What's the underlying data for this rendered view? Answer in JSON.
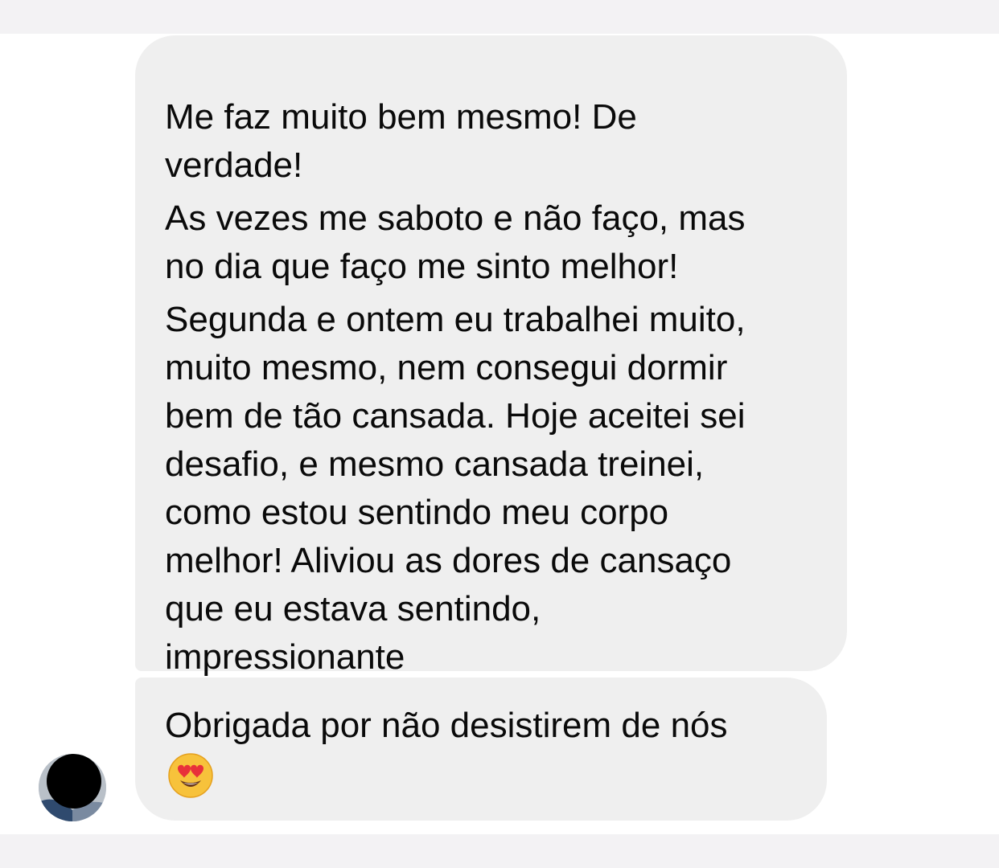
{
  "thread": {
    "messages": [
      {
        "paragraphs": [
          "Me faz muito bem mesmo! De\nverdade!",
          "As vezes me saboto e não faço, mas\nno dia que faço me sinto melhor!",
          "Segunda e ontem eu trabalhei muito,\nmuito mesmo, nem consegui dormir\nbem de tão cansada. Hoje aceitei sei\ndesafio, e mesmo cansada treinei,\ncomo estou sentindo meu corpo\nmelhor! Aliviou as dores de cansaço\nque eu estava sentindo,\nimpressionante"
        ]
      },
      {
        "text": "Obrigada por não desistirem de nós",
        "emoji": "heart-eyes-emoji"
      }
    ],
    "avatar": "contact-avatar",
    "colors": {
      "bubble": "#efefef",
      "text": "#0a0a0a",
      "background": "#ffffff",
      "strip": "#f3f2f4"
    }
  }
}
